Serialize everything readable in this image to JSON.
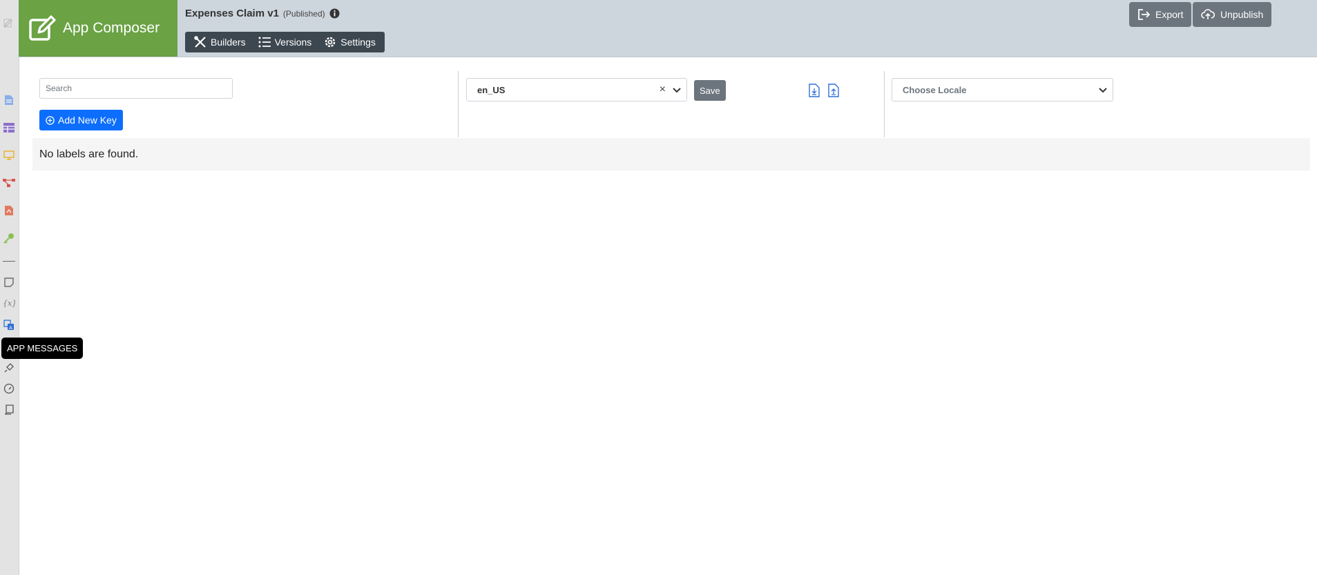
{
  "colors": {
    "brand_green": "#6aa244",
    "header_bg": "#cdd5dd",
    "navbar_bg": "#3d4750",
    "primary_blue": "#0d6efd",
    "secondary_gray": "#6c757d"
  },
  "rail": {
    "items": [
      {
        "icon": "document-icon"
      },
      {
        "icon": "table-icon"
      },
      {
        "icon": "monitor-icon"
      },
      {
        "icon": "workflow-icon"
      },
      {
        "icon": "pdf-icon"
      },
      {
        "icon": "key-icon"
      },
      {
        "icon": "note-icon"
      },
      {
        "icon": "variable-icon"
      },
      {
        "icon": "translate-icon"
      },
      {
        "icon": "plug-icon"
      },
      {
        "icon": "gauge-icon"
      },
      {
        "icon": "scroll-icon"
      }
    ],
    "tooltip": "APP MESSAGES"
  },
  "header": {
    "brand_title": "App Composer",
    "app_title": "Expenses Claim v1",
    "app_status": "(Published)",
    "nav": [
      {
        "label": "Builders",
        "icon": "builders-icon"
      },
      {
        "label": "Versions",
        "icon": "list-icon"
      },
      {
        "label": "Settings",
        "icon": "gear-icon"
      }
    ],
    "export_label": "Export",
    "unpublish_label": "Unpublish"
  },
  "main": {
    "search_placeholder": "Search",
    "add_key_label": "Add New Key",
    "locale_value": "en_US",
    "clear_symbol": "×",
    "save_label": "Save",
    "choose_locale_placeholder": "Choose Locale",
    "empty_message": "No labels are found."
  }
}
